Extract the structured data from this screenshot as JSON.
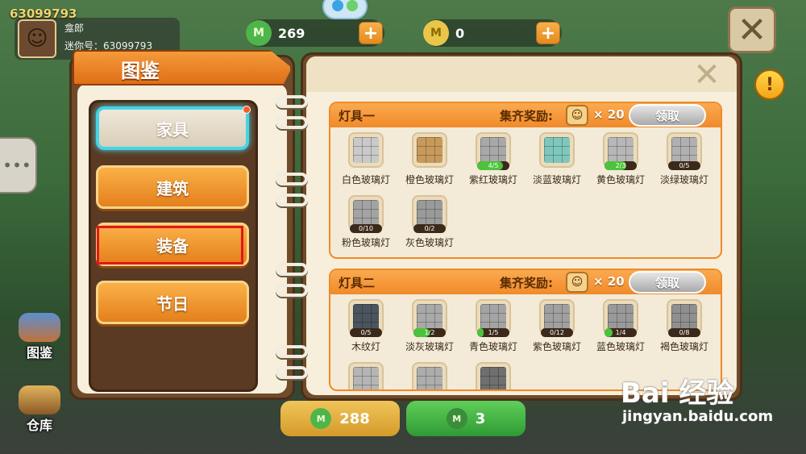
{
  "hud": {
    "uid": "63099793",
    "profile_name": "龛郎",
    "profile_id": "迷你号：63099793",
    "currency1_value": "269",
    "currency2_value": "0",
    "plus": "+",
    "close_glyph": "✕",
    "alert_glyph": "!",
    "chat_glyph": "•••"
  },
  "side": {
    "handbook_label": "图鉴",
    "warehouse_label": "仓库"
  },
  "book": {
    "title": "图鉴",
    "close_glyph": "✕",
    "categories": [
      {
        "label": "家具",
        "selected": true
      },
      {
        "label": "建筑",
        "selected": false
      },
      {
        "label": "装备",
        "selected": false
      },
      {
        "label": "节日",
        "selected": false
      }
    ]
  },
  "sections": [
    {
      "title": "灯具一",
      "reward_label": "集齐奖励:",
      "reward_count": "× 20",
      "claim_label": "领取",
      "items": [
        {
          "name": "白色玻璃灯",
          "progress": "",
          "fraction": 0,
          "color": "#c9c9c9"
        },
        {
          "name": "橙色玻璃灯",
          "progress": "",
          "fraction": 0,
          "color": "#c79a5c"
        },
        {
          "name": "紫红玻璃灯",
          "progress": "4/5",
          "fraction": 0.8,
          "color": "#a8a8a8"
        },
        {
          "name": "淡蓝玻璃灯",
          "progress": "",
          "fraction": 0,
          "color": "#7fc7bd"
        },
        {
          "name": "黄色玻璃灯",
          "progress": "2/3",
          "fraction": 0.67,
          "color": "#b7b7b7"
        },
        {
          "name": "淡绿玻璃灯",
          "progress": "0/5",
          "fraction": 0,
          "color": "#b0b0b0"
        },
        {
          "name": "粉色玻璃灯",
          "progress": "0/10",
          "fraction": 0,
          "color": "#a3a3a3"
        },
        {
          "name": "灰色玻璃灯",
          "progress": "0/2",
          "fraction": 0,
          "color": "#9a9a9a"
        }
      ]
    },
    {
      "title": "灯具二",
      "reward_label": "集齐奖励:",
      "reward_count": "× 20",
      "claim_label": "领取",
      "items": [
        {
          "name": "木纹灯",
          "progress": "0/5",
          "fraction": 0,
          "color": "#4a5560"
        },
        {
          "name": "淡灰玻璃灯",
          "progress": "1/2",
          "fraction": 0.5,
          "color": "#a9a9a9"
        },
        {
          "name": "青色玻璃灯",
          "progress": "1/5",
          "fraction": 0.2,
          "color": "#a4a4a4"
        },
        {
          "name": "紫色玻璃灯",
          "progress": "0/12",
          "fraction": 0,
          "color": "#a0a0a0"
        },
        {
          "name": "蓝色玻璃灯",
          "progress": "1/4",
          "fraction": 0.25,
          "color": "#999999"
        },
        {
          "name": "褐色玻璃灯",
          "progress": "0/8",
          "fraction": 0,
          "color": "#8f8f8f"
        },
        {
          "name": "",
          "progress": "",
          "fraction": 0,
          "color": "#b5b5b5"
        },
        {
          "name": "",
          "progress": "",
          "fraction": 0,
          "color": "#adadad"
        },
        {
          "name": "",
          "progress": "",
          "fraction": 0,
          "color": "#6f6f6f"
        }
      ]
    }
  ],
  "bottom": {
    "left_value": "288",
    "right_value": "3"
  },
  "watermark": {
    "brand": "Bai  经验",
    "url": "jingyan.baidu.com"
  }
}
